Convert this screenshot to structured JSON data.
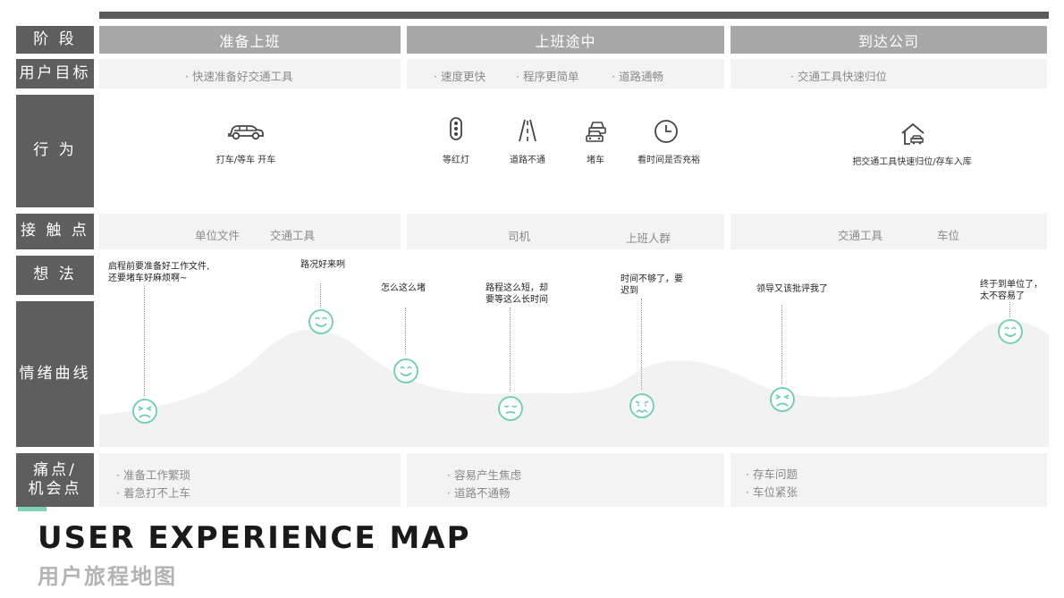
{
  "rows": {
    "stage": "阶 段",
    "goal": "用户目标",
    "behavior": "行 为",
    "touchpoint": "接 触 点",
    "thought": "想 法",
    "emotion": "情绪曲线",
    "pain_line1": "痛点/",
    "pain_line2": "机会点"
  },
  "phases": [
    "准备上班",
    "上班途中",
    "到达公司"
  ],
  "goals": {
    "p1": "· 快速准备好交通工具",
    "p2": [
      "· 速度更快",
      "· 程序更简单",
      "· 道路通畅"
    ],
    "p3": "· 交通工具快速归位"
  },
  "actions": [
    {
      "icon": "car-icon",
      "label": "打车/等车 开车"
    },
    {
      "icon": "traffic-light-icon",
      "label": "等红灯"
    },
    {
      "icon": "road-icon",
      "label": "道路不通"
    },
    {
      "icon": "traffic-jam-icon",
      "label": "堵车"
    },
    {
      "icon": "clock-icon",
      "label": "看时间是否充裕"
    },
    {
      "icon": "garage-icon",
      "label": "把交通工具快速归位/存车入库"
    }
  ],
  "touchpoints": {
    "p1": [
      "单位文件",
      "交通工具"
    ],
    "p2": [
      "司机",
      "上班人群"
    ],
    "p3": [
      "交通工具",
      "车位"
    ]
  },
  "thoughts": [
    {
      "lines": [
        "启程前要准备好工作文件,",
        "还要堵车好麻烦啊~"
      ],
      "face": "frown"
    },
    {
      "lines": [
        "路况好来咧"
      ],
      "face": "smile"
    },
    {
      "lines": [
        "怎么这么堵"
      ],
      "face": "smile"
    },
    {
      "lines": [
        "路程这么短，却",
        "要等这么长时间"
      ],
      "face": "meh"
    },
    {
      "lines": [
        "时间不够了，要",
        "迟到"
      ],
      "face": "worried"
    },
    {
      "lines": [
        "领导又该批评我了"
      ],
      "face": "frown"
    },
    {
      "lines": [
        "终于到单位了，",
        "太不容易了"
      ],
      "face": "smile"
    }
  ],
  "pain": {
    "p1": [
      "· 准备工作繁琐",
      "· 着急打不上车"
    ],
    "p2": [
      "· 容易产生焦虑",
      "· 道路不通畅"
    ],
    "p3": [
      "· 存车问题",
      "· 车位紧张"
    ]
  },
  "title_en": "USER EXPERIENCE MAP",
  "title_cn": "用户旅程地图",
  "colors": {
    "label_bg": "#5e5e5e",
    "phase_bg": "#a7a7a7",
    "cell_bg": "#f3f3f3",
    "face": "#6ccfad",
    "curve": "#f1f1f1"
  }
}
